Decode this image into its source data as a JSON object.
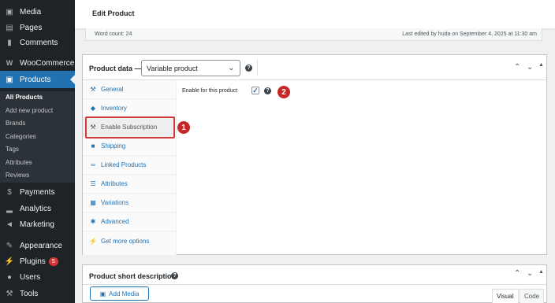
{
  "sidebar": {
    "items": [
      {
        "label": "Media",
        "icon": "media-icon"
      },
      {
        "label": "Pages",
        "icon": "pages-icon"
      },
      {
        "label": "Comments",
        "icon": "comments-icon"
      },
      {
        "label": "WooCommerce",
        "icon": "woocommerce-icon"
      },
      {
        "label": "Products",
        "icon": "products-icon"
      },
      {
        "label": "Payments",
        "icon": "payments-icon"
      },
      {
        "label": "Analytics",
        "icon": "analytics-icon"
      },
      {
        "label": "Marketing",
        "icon": "marketing-icon"
      },
      {
        "label": "Appearance",
        "icon": "appearance-icon"
      },
      {
        "label": "Plugins",
        "icon": "plugins-icon",
        "badge": "5"
      },
      {
        "label": "Users",
        "icon": "users-icon"
      },
      {
        "label": "Tools",
        "icon": "tools-icon"
      }
    ],
    "products_submenu": [
      "All Products",
      "Add new product",
      "Brands",
      "Categories",
      "Tags",
      "Attributes",
      "Reviews"
    ]
  },
  "header": {
    "title": "Edit Product"
  },
  "word_bar": {
    "word_count": "Word count: 24",
    "last_edited": "Last edited by huda on September 4, 2025 at 11:30 am"
  },
  "product_data": {
    "title": "Product data —",
    "type_select": "Variable product",
    "tabs": [
      {
        "label": "General",
        "icon": "wrench-icon"
      },
      {
        "label": "Inventory",
        "icon": "tag-icon"
      },
      {
        "label": "Enable Subscription",
        "icon": "wrench-icon"
      },
      {
        "label": "Shipping",
        "icon": "truck-icon"
      },
      {
        "label": "Linked Products",
        "icon": "link-icon"
      },
      {
        "label": "Attributes",
        "icon": "list-icon"
      },
      {
        "label": "Variations",
        "icon": "grid-icon"
      },
      {
        "label": "Advanced",
        "icon": "gear-icon"
      },
      {
        "label": "Get more options",
        "icon": "plugin-icon"
      }
    ],
    "enable_label": "Enable for this product",
    "enable_checked": true
  },
  "annotations": [
    "1",
    "2"
  ],
  "short_description": {
    "title": "Product short description",
    "add_media": "Add Media",
    "visual_tab": "Visual",
    "code_tab": "Code"
  },
  "colors": {
    "accent": "#2271b1",
    "sidebar": "#1d2327",
    "annotation": "#c62828"
  }
}
